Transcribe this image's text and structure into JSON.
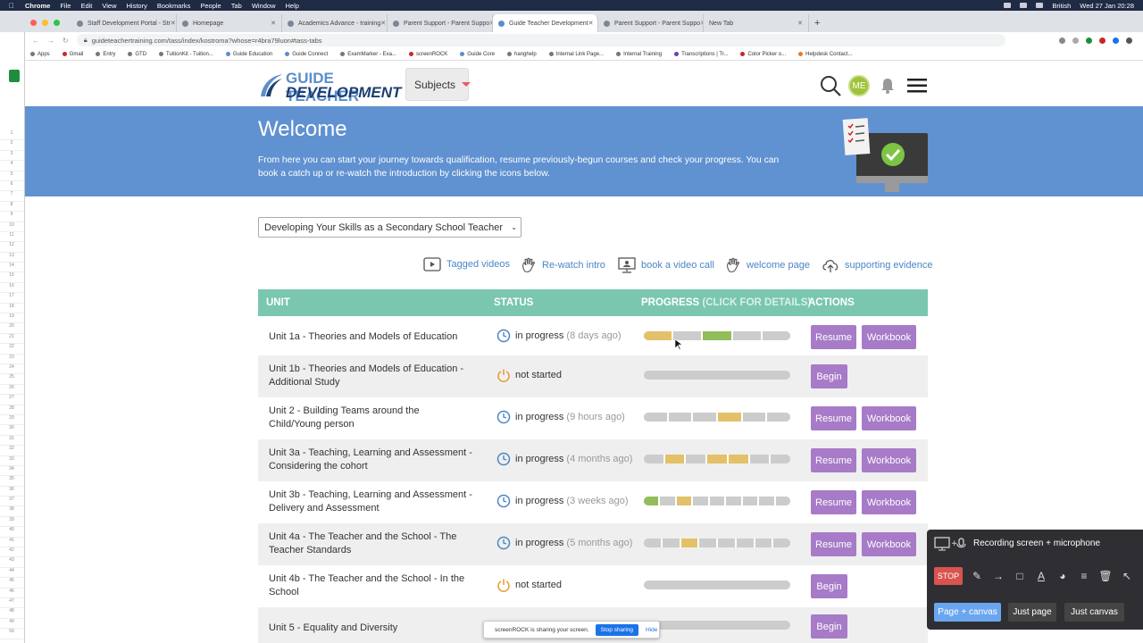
{
  "menubar": {
    "items": [
      "Chrome",
      "File",
      "Edit",
      "View",
      "History",
      "Bookmarks",
      "People",
      "Tab",
      "Window",
      "Help"
    ],
    "input_lang": "British",
    "clock": "Wed 27 Jan 20:28"
  },
  "tabs": [
    {
      "label": "Staff Development Portal - Str",
      "active": false
    },
    {
      "label": "Homepage",
      "active": false
    },
    {
      "label": "Academics Advance - training",
      "active": false
    },
    {
      "label": "Parent Support - Parent Suppo",
      "active": false
    },
    {
      "label": "Guide Teacher Development",
      "active": true
    },
    {
      "label": "Parent Support - Parent Suppo",
      "active": false
    },
    {
      "label": "New Tab",
      "active": false
    }
  ],
  "address": {
    "url": "guideteachertraining.com/tass/index/kostroma?whose=r4bra79luon#tass-tabs"
  },
  "bookmarks": [
    "Apps",
    "Gmail",
    "Entry",
    "GTD",
    "TuitionKit - Tuition...",
    "Guide Education",
    "Guide Connect",
    "ExamMarker - Exa...",
    "screenROCK",
    "Guide Core",
    "hanghelp",
    "Internal Link Page...",
    "Internal Training",
    "Transcriptions | Tr...",
    "Color Picker o...",
    "Helpdesk Contact..."
  ],
  "header": {
    "logo_line1": "GUIDE TEACHER",
    "logo_line2": "DEVELOPMENT",
    "subjects_label": "Subjects",
    "avatar_initials": "ME"
  },
  "banner": {
    "title": "Welcome",
    "text": "From here you can start your journey towards qualification, resume previously-begun courses and check your progress. You can book a catch up or re-watch the introduction by clicking the icons below."
  },
  "course_select": {
    "value": "Developing Your Skills as a Secondary School Teacher"
  },
  "quick_links": [
    {
      "label": "Tagged videos",
      "icon": "video-icon"
    },
    {
      "label": "Re-watch intro",
      "icon": "hand-wave-icon"
    },
    {
      "label": "book a video call",
      "icon": "video-call-icon"
    },
    {
      "label": "welcome page",
      "icon": "hand-wave-icon"
    },
    {
      "label": "supporting evidence",
      "icon": "upload-cloud-icon"
    }
  ],
  "table": {
    "headers": {
      "unit": "UNIT",
      "status": "STATUS",
      "progress": "PROGRESS",
      "progress_hint": "(CLICK FOR DETAILS)",
      "actions": "ACTIONS"
    },
    "labels": {
      "resume": "Resume",
      "workbook": "Workbook",
      "begin": "Begin"
    },
    "colors": {
      "done": "#93bd5a",
      "partial": "#e3c16a",
      "empty": "#cccccc"
    },
    "rows": [
      {
        "unit": "Unit 1a - Theories and Models of Education",
        "status": "in progress",
        "ago": "(8 days ago)",
        "state": "progress",
        "segments": [
          "partial",
          "empty",
          "done",
          "empty",
          "empty"
        ]
      },
      {
        "unit": "Unit 1b - Theories and Models of Education - Additional Study",
        "status": "not started",
        "ago": "",
        "state": "not",
        "segments": []
      },
      {
        "unit": "Unit 2 - Building Teams around the Child/Young person",
        "status": "in progress",
        "ago": "(9 hours ago)",
        "state": "progress",
        "segments": [
          "empty",
          "empty",
          "empty",
          "partial",
          "empty",
          "empty"
        ]
      },
      {
        "unit": "Unit 3a - Teaching, Learning and Assessment - Considering the cohort",
        "status": "in progress",
        "ago": "(4 months ago)",
        "state": "progress",
        "segments": [
          "empty",
          "partial",
          "empty",
          "partial",
          "partial",
          "empty",
          "empty"
        ]
      },
      {
        "unit": "Unit 3b - Teaching, Learning and Assessment - Delivery and Assessment",
        "status": "in progress",
        "ago": "(3 weeks ago)",
        "state": "progress",
        "segments": [
          "done",
          "empty",
          "partial",
          "empty",
          "empty",
          "empty",
          "empty",
          "empty",
          "empty"
        ]
      },
      {
        "unit": "Unit 4a - The Teacher and the School - The Teacher Standards",
        "status": "in progress",
        "ago": "(5 months ago)",
        "state": "progress",
        "segments": [
          "empty",
          "empty",
          "partial",
          "empty",
          "empty",
          "empty",
          "empty",
          "empty"
        ]
      },
      {
        "unit": "Unit 4b - The Teacher and the School - In the School",
        "status": "not started",
        "ago": "",
        "state": "not",
        "segments": []
      },
      {
        "unit": "Unit 5 - Equality and Diversity",
        "status": "",
        "ago": "",
        "state": "not",
        "segments": []
      }
    ]
  },
  "screenrock": {
    "title": "Recording screen + microphone",
    "stop": "STOP",
    "options": [
      "Page + canvas",
      "Just page",
      "Just canvas"
    ]
  },
  "share_notice": {
    "text": "screenROCK is sharing your screen.",
    "stop": "Stop sharing",
    "hide": "Hide"
  }
}
